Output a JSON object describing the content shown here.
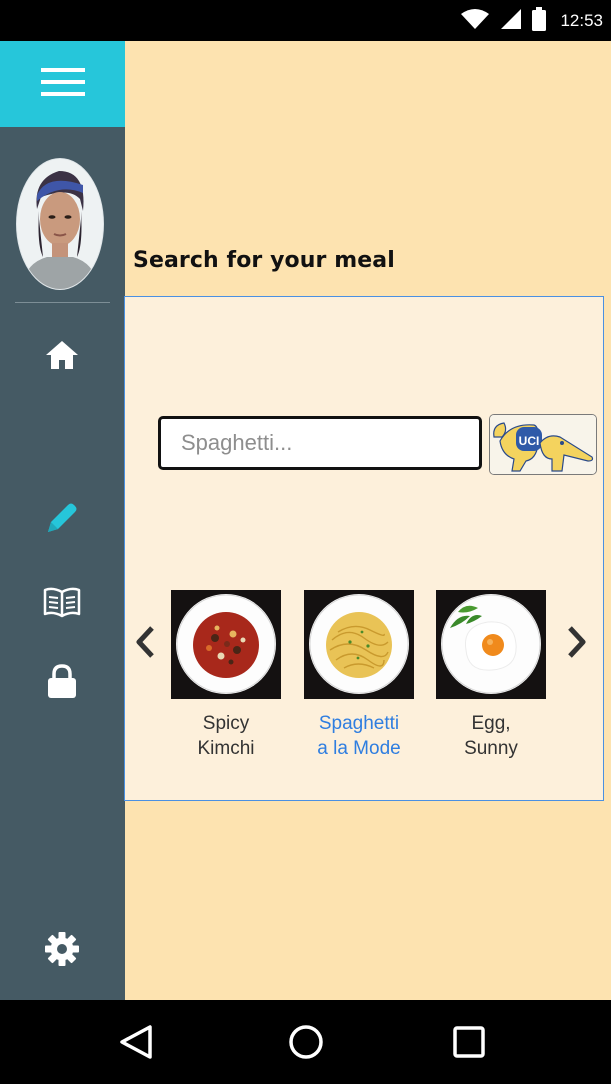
{
  "status_bar": {
    "time": "12:53",
    "icons": [
      "wifi-icon",
      "signal-icon",
      "battery-icon"
    ]
  },
  "sidebar": {
    "menu_icon": "hamburger-menu-icon",
    "accent_color": "#26c6da",
    "background_color": "#455a64",
    "items": [
      {
        "name": "home",
        "icon": "home-icon",
        "active": false
      },
      {
        "name": "edit",
        "icon": "pencil-icon",
        "active": true
      },
      {
        "name": "book",
        "icon": "open-book-icon",
        "active": false
      },
      {
        "name": "lock",
        "icon": "lock-icon",
        "active": false
      },
      {
        "name": "settings",
        "icon": "gear-icon",
        "active": false
      }
    ]
  },
  "main": {
    "title": "Search for your meal",
    "search": {
      "placeholder": "Spaghetti...",
      "value": ""
    },
    "search_button_logo": {
      "text": "UCI"
    },
    "carousel": {
      "prev_icon": "chevron-left-icon",
      "next_icon": "chevron-right-icon",
      "meals": [
        {
          "line1": "Spicy",
          "line2": "Kimchi",
          "selected": false
        },
        {
          "line1": "Spaghetti",
          "line2": "a la Mode",
          "selected": true
        },
        {
          "line1": "Egg,",
          "line2": "Sunny",
          "selected": false
        }
      ]
    }
  },
  "nav_bar": {
    "back_icon": "back-triangle-icon",
    "home_icon": "home-circle-icon",
    "recents_icon": "recents-square-icon"
  }
}
